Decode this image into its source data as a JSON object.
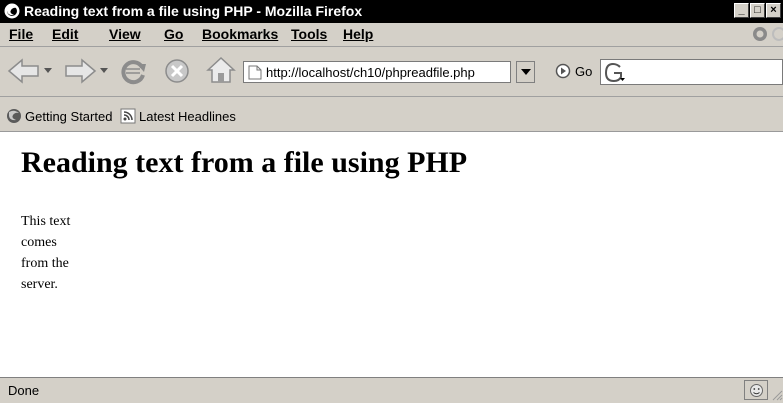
{
  "window": {
    "title": "Reading text from a file using PHP - Mozilla Firefox",
    "buttons": {
      "minimize": "_",
      "maximize": "□",
      "close": "×"
    }
  },
  "menu": {
    "items": [
      {
        "label": "File",
        "accel": "F"
      },
      {
        "label": "Edit",
        "accel": "E"
      },
      {
        "label": "View",
        "accel": "V"
      },
      {
        "label": "Go",
        "accel": "G"
      },
      {
        "label": "Bookmarks",
        "accel": "B"
      },
      {
        "label": "Tools",
        "accel": "T"
      },
      {
        "label": "Help",
        "accel": "H"
      }
    ]
  },
  "toolbar": {
    "url": "http://localhost/ch10/phpreadfile.php",
    "go_label": "Go",
    "icons": [
      "back-icon",
      "forward-icon",
      "reload-icon",
      "stop-icon",
      "home-icon",
      "page-icon",
      "go-icon",
      "search-engine-icon"
    ]
  },
  "bookmarks": {
    "items": [
      {
        "label": "Getting Started",
        "icon": "firefox-icon"
      },
      {
        "label": "Latest Headlines",
        "icon": "rss-icon"
      }
    ]
  },
  "page": {
    "heading": "Reading text from a file using PHP",
    "paragraph": "This text comes from the server."
  },
  "status": {
    "text": "Done"
  },
  "colors": {
    "titlebar": "#000000",
    "chrome": "#d4d0c8",
    "content": "#ffffff"
  }
}
